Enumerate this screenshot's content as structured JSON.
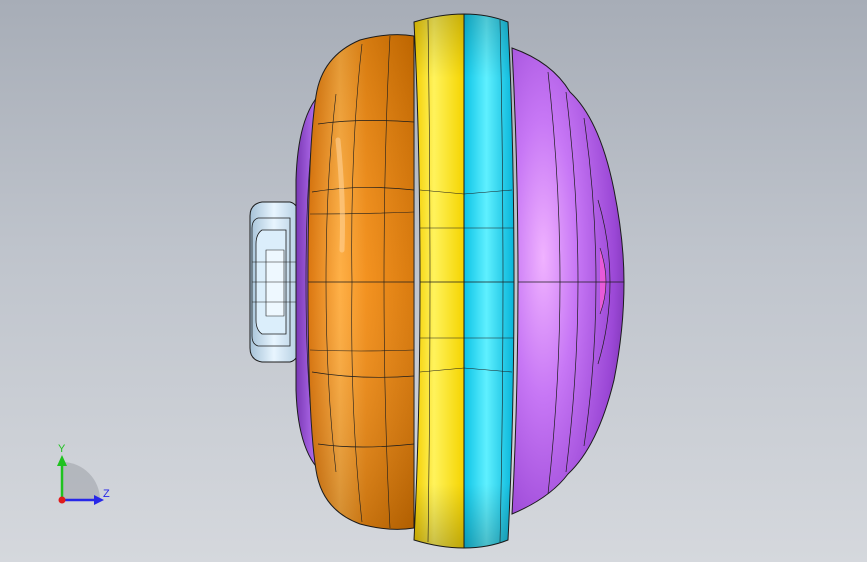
{
  "viewport": {
    "background_top": "#a7adb7",
    "background_bottom": "#d5d8dd"
  },
  "model": {
    "parts": [
      {
        "name": "handle",
        "color": "#cfe6f5"
      },
      {
        "name": "rear-cover",
        "color": "#9a55d6"
      },
      {
        "name": "orange-shell",
        "color": "#f08a10"
      },
      {
        "name": "yellow-ring",
        "color": "#ffe11a"
      },
      {
        "name": "cyan-ring",
        "color": "#19d4f2"
      },
      {
        "name": "purple-dome",
        "color": "#b463ee"
      }
    ],
    "edge_color": "#1c1c1c"
  },
  "triad": {
    "y_label": "Y",
    "z_label": "Z",
    "y_color": "#1fc21f",
    "z_color": "#2727e8",
    "x_color": "#e01b1b",
    "sphere_color": "#8e8e8e"
  }
}
